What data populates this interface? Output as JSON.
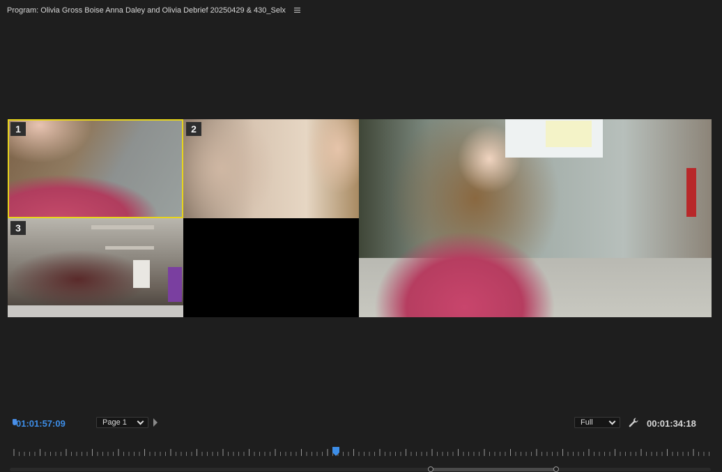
{
  "panel": {
    "title": "Program: Olivia Gross Boise Anna Daley and Olivia Debrief 20250429 & 430_Selx",
    "menu_icon": "hamburger-menu-icon"
  },
  "multicam": {
    "cameras": [
      {
        "number": "1",
        "selected": true
      },
      {
        "number": "2",
        "selected": false
      },
      {
        "number": "3",
        "selected": false
      }
    ],
    "selected_color": "#e8d51c"
  },
  "controls": {
    "playhead_timecode": "01:01:57:09",
    "page_select": {
      "value": "Page 1"
    },
    "resolution_select": {
      "value": "Full"
    },
    "settings_icon": "wrench-icon",
    "duration_timecode": "00:01:34:18"
  },
  "colors": {
    "accent": "#3d8ee8",
    "background": "#1e1e1e"
  }
}
